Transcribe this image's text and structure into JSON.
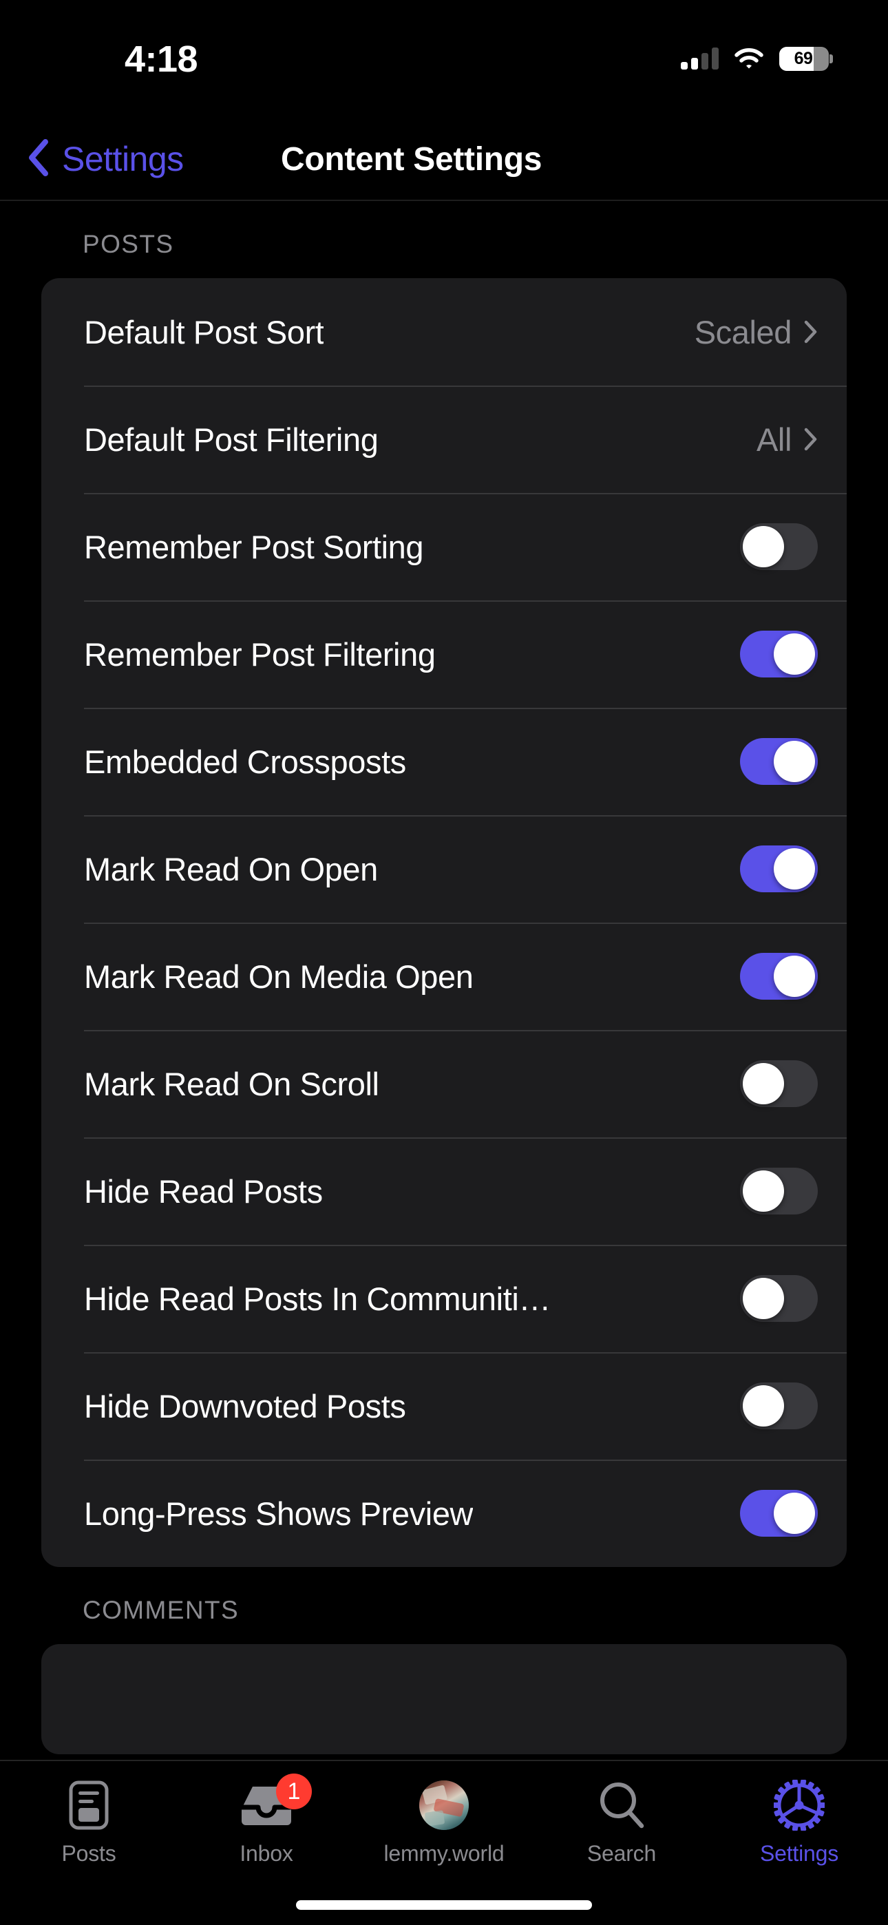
{
  "status_bar": {
    "time": "4:18",
    "battery_percent": "69",
    "signal_icon": "cellular-signal-icon",
    "wifi_icon": "wifi-icon",
    "battery_icon": "battery-icon",
    "signal_bars_filled": 2,
    "signal_bars_total": 4
  },
  "nav": {
    "back_label": "Settings",
    "back_icon": "chevron-left-icon",
    "title": "Content Settings"
  },
  "sections": [
    {
      "header": "POSTS",
      "rows": [
        {
          "label": "Default Post Sort",
          "type": "disclosure",
          "value": "Scaled",
          "icon": "chevron-right-icon"
        },
        {
          "label": "Default Post Filtering",
          "type": "disclosure",
          "value": "All",
          "icon": "chevron-right-icon"
        },
        {
          "label": "Remember Post Sorting",
          "type": "toggle",
          "state": "off"
        },
        {
          "label": "Remember Post Filtering",
          "type": "toggle",
          "state": "on"
        },
        {
          "label": "Embedded Crossposts",
          "type": "toggle",
          "state": "on"
        },
        {
          "label": "Mark Read On Open",
          "type": "toggle",
          "state": "on"
        },
        {
          "label": "Mark Read On Media Open",
          "type": "toggle",
          "state": "on"
        },
        {
          "label": "Mark Read On Scroll",
          "type": "toggle",
          "state": "off"
        },
        {
          "label": "Hide Read Posts",
          "type": "toggle",
          "state": "off"
        },
        {
          "label": "Hide Read Posts In Communiti…",
          "type": "toggle",
          "state": "off"
        },
        {
          "label": "Hide Downvoted Posts",
          "type": "toggle",
          "state": "off"
        },
        {
          "label": "Long-Press Shows Preview",
          "type": "toggle",
          "state": "on"
        }
      ]
    },
    {
      "header": "COMMENTS",
      "rows": []
    }
  ],
  "tabbar": {
    "items": [
      {
        "label": "Posts",
        "icon": "posts-card-icon",
        "active": false,
        "badge": ""
      },
      {
        "label": "Inbox",
        "icon": "inbox-tray-icon",
        "active": false,
        "badge": "1"
      },
      {
        "label": "lemmy.world",
        "icon": "account-avatar",
        "active": false,
        "badge": ""
      },
      {
        "label": "Search",
        "icon": "magnifier-icon",
        "active": false,
        "badge": ""
      },
      {
        "label": "Settings",
        "icon": "gear-icon",
        "active": true,
        "badge": ""
      }
    ]
  },
  "colors": {
    "accent": "#5a51e8",
    "toggle_on": "#5a51e8",
    "toggle_off": "#39393d",
    "card_bg": "#1c1c1e",
    "page_bg": "#000000",
    "badge_red": "#ff3b30",
    "secondary_text": "#8b8b90"
  }
}
